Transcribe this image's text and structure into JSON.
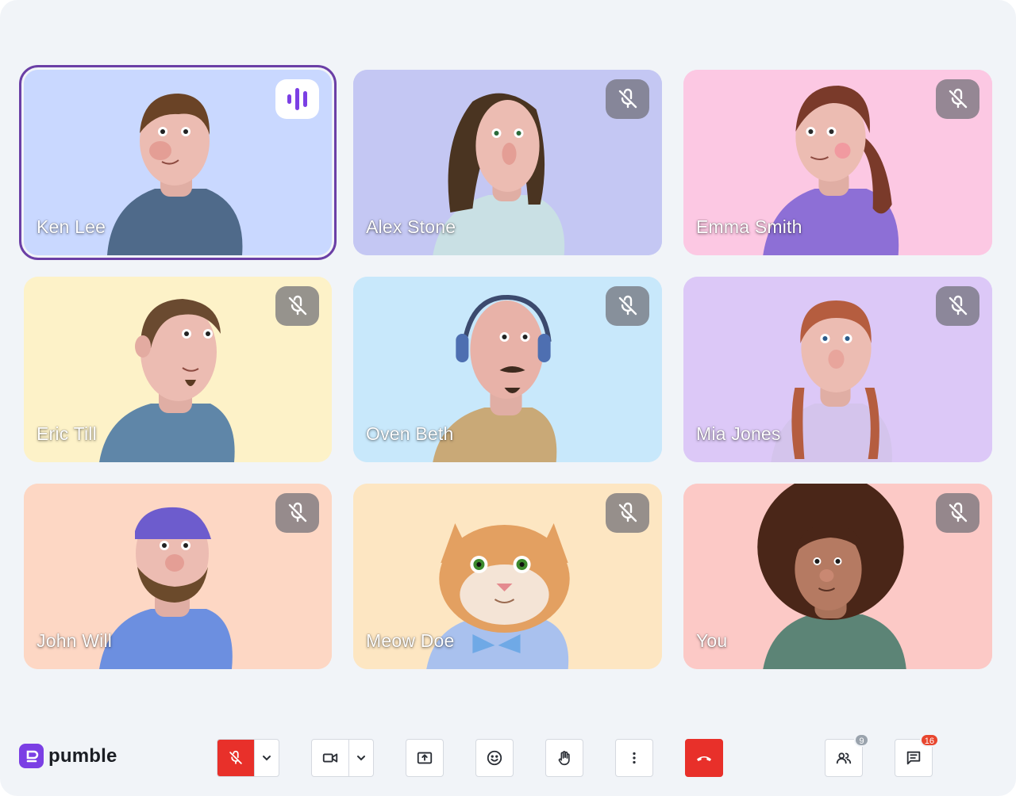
{
  "brand": {
    "name": "pumble",
    "accent": "#7b3fe4"
  },
  "participants": [
    {
      "name": "Ken Lee",
      "bg": "#c9d8ff",
      "status": "speaking",
      "shirt": "#4f6a8a",
      "hair": "#6a4326"
    },
    {
      "name": "Alex Stone",
      "bg": "#c4c7f3",
      "status": "muted",
      "shirt": "#c9e0e4",
      "hair": "#4a3421"
    },
    {
      "name": "Emma Smith",
      "bg": "#fcc8e3",
      "status": "muted",
      "shirt": "#8d6fd6",
      "hair": "#7a3a2a"
    },
    {
      "name": "Eric Till",
      "bg": "#fdf2c8",
      "status": "muted",
      "shirt": "#5f86a8",
      "hair": "#6a4a30"
    },
    {
      "name": "Oven Beth",
      "bg": "#c8e8fb",
      "status": "muted",
      "shirt": "#c9a977",
      "hair": "#5a4030"
    },
    {
      "name": "Mia Jones",
      "bg": "#dcc8f7",
      "status": "muted",
      "shirt": "#d4c4ec",
      "hair": "#b55d3f"
    },
    {
      "name": "John Will",
      "bg": "#fdd7c4",
      "status": "muted",
      "shirt": "#6c8fe0",
      "hair": "#6b4a2b"
    },
    {
      "name": "Meow Doe",
      "bg": "#fde6c2",
      "status": "muted",
      "shirt": "#a9c1ee",
      "hair": "#e3a061"
    },
    {
      "name": "You",
      "bg": "#fcc9c6",
      "status": "muted",
      "shirt": "#5c8476",
      "hair": "#4a2618"
    }
  ],
  "toolbar": {
    "people_count": "9",
    "chat_count": "16",
    "people_badge_color": "#9aa3ad",
    "chat_badge_color": "#e8462f"
  }
}
